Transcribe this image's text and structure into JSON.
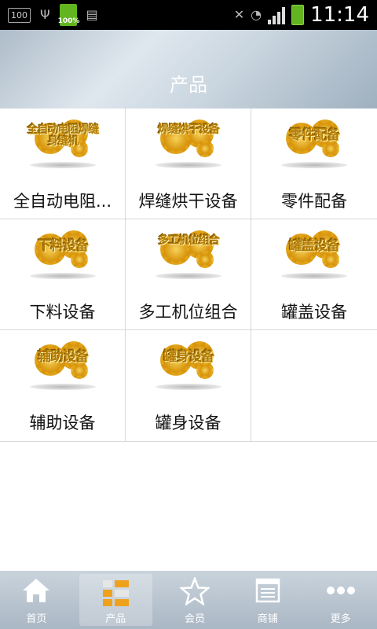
{
  "status_bar": {
    "left_indicator": "100",
    "battery_small_label": "100%",
    "time": "11:14"
  },
  "header": {
    "title": "产品"
  },
  "products": [
    {
      "label": "全自动电阻...",
      "thumb_text": "全自动电阻焊缝身缝机",
      "thumb_small": true
    },
    {
      "label": "焊缝烘干设备",
      "thumb_text": "焊缝烘干设备",
      "thumb_small": true
    },
    {
      "label": "零件配备",
      "thumb_text": "零件配备",
      "thumb_small": false
    },
    {
      "label": "下料设备",
      "thumb_text": "下料设备",
      "thumb_small": false
    },
    {
      "label": "多工机位组合",
      "thumb_text": "多工机位组合",
      "thumb_small": true
    },
    {
      "label": "罐盖设备",
      "thumb_text": "罐盖设备",
      "thumb_small": false
    },
    {
      "label": "辅助设备",
      "thumb_text": "辅助设备",
      "thumb_small": false
    },
    {
      "label": "罐身设备",
      "thumb_text": "罐身设备",
      "thumb_small": false
    }
  ],
  "tabs": [
    {
      "label": "首页",
      "icon": "home-icon"
    },
    {
      "label": "产品",
      "icon": "grid-icon",
      "active": true
    },
    {
      "label": "会员",
      "icon": "star-icon"
    },
    {
      "label": "商铺",
      "icon": "store-icon"
    },
    {
      "label": "更多",
      "icon": "more-icon"
    }
  ]
}
